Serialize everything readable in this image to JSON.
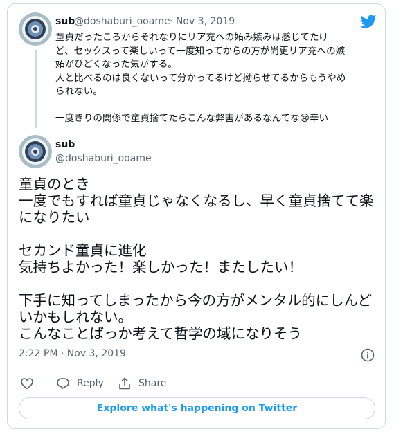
{
  "quoted_tweet": {
    "name": "sub",
    "handle": "@doshaburi_ooame",
    "date": "· Nov 3, 2019",
    "text": "童貞だったころからそれなりにリア充への妬み嫉みは感じてたけ\nど、セックスって楽しいって一度知ってからの方が尚更リア充への嫉\n妬がひどくなった気がする。\n人と比べるのは良くないって分かってるけど拗らせてるからもうやめ\nられない。\n\n一度きりの関係で童貞捨てたらこんな弊害があるなんてな😢辛い"
  },
  "main_tweet": {
    "name": "sub",
    "handle": "@doshaburi_ooame",
    "text": "童貞のとき\n一度でもすれば童貞じゃなくなるし、早く童貞捨てて楽\nになりたい\n\nセカンド童貞に進化\n気持ちよかった！楽しかった！またしたい！\n\n下手に知ってしまったから今の方がメンタル的にしんど\nいかもしれない。\nこんなことばっか考えて哲学の域になりそう",
    "timestamp": "2:22 PM · Nov 3, 2019"
  },
  "actions": {
    "reply_label": "Reply",
    "share_label": "Share"
  },
  "explore_label": "Explore what's happening on Twitter",
  "colors": {
    "accent": "#1d9bf0",
    "secondary_text": "#536471",
    "border": "#cfd9de"
  },
  "icons": [
    "twitter-bird-icon",
    "heart-icon",
    "reply-icon",
    "share-icon",
    "info-icon"
  ]
}
